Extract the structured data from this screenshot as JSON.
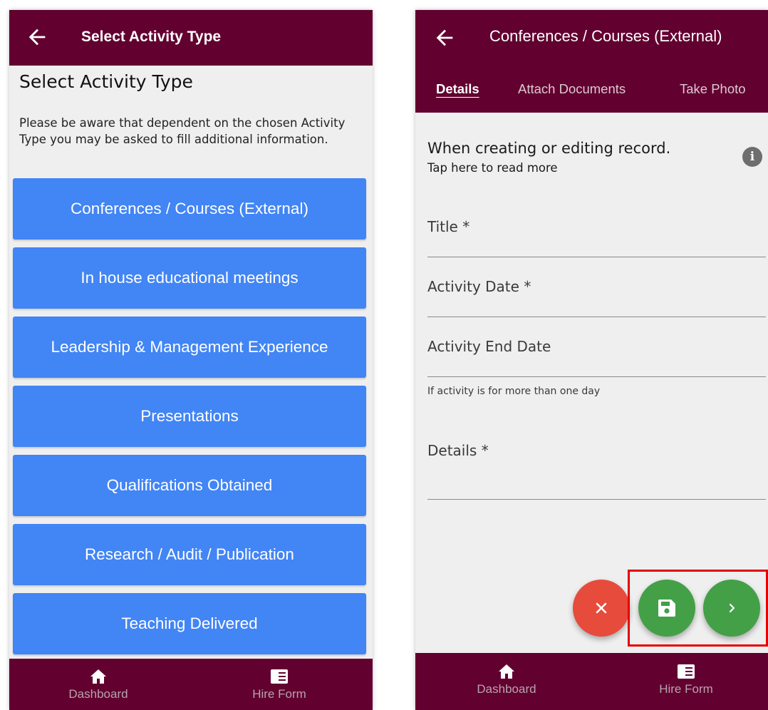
{
  "left_screen": {
    "app_bar": {
      "back_icon": "arrow-left-icon",
      "title": "Select Activity Type"
    },
    "heading": "Select Activity Type",
    "notice": "Please be aware that dependent on the chosen Activity Type you may be asked to fill additional information.",
    "activity_types": [
      "Conferences / Courses (External)",
      "In house educational meetings",
      "Leadership & Management Experience",
      "Presentations",
      "Qualifications Obtained",
      "Research / Audit / Publication",
      "Teaching Delivered"
    ],
    "bottom_nav": [
      {
        "icon": "home-icon",
        "label": "Dashboard"
      },
      {
        "icon": "form-icon",
        "label": "Hire Form"
      }
    ]
  },
  "right_screen": {
    "app_bar": {
      "back_icon": "arrow-left-icon",
      "title": "Conferences / Courses (External)"
    },
    "tabs": [
      {
        "label": "Details",
        "active": true
      },
      {
        "label": "Attach Documents",
        "active": false
      },
      {
        "label": "Take Photo",
        "active": false
      }
    ],
    "info": {
      "title": "When creating or editing record.",
      "subtitle": "Tap here to read more",
      "icon": "info-icon",
      "icon_glyph": "i"
    },
    "fields": {
      "title": "Title *",
      "activity_date": "Activity Date *",
      "activity_end_date": "Activity End Date",
      "activity_end_date_helper": "If activity is for more than one day",
      "details": "Details *"
    },
    "fab_buttons": [
      {
        "icon": "close-icon",
        "color": "#e74b3c"
      },
      {
        "icon": "save-icon",
        "color": "#43a047"
      },
      {
        "icon": "chevron-right-icon",
        "color": "#43a047"
      }
    ],
    "bottom_nav": [
      {
        "icon": "home-icon",
        "label": "Dashboard"
      },
      {
        "icon": "form-icon",
        "label": "Hire Form"
      }
    ]
  },
  "colors": {
    "app_bar": "#620030",
    "activity_button": "#4285f4",
    "screen_background": "#efefef",
    "highlight_box": "#e60000"
  }
}
